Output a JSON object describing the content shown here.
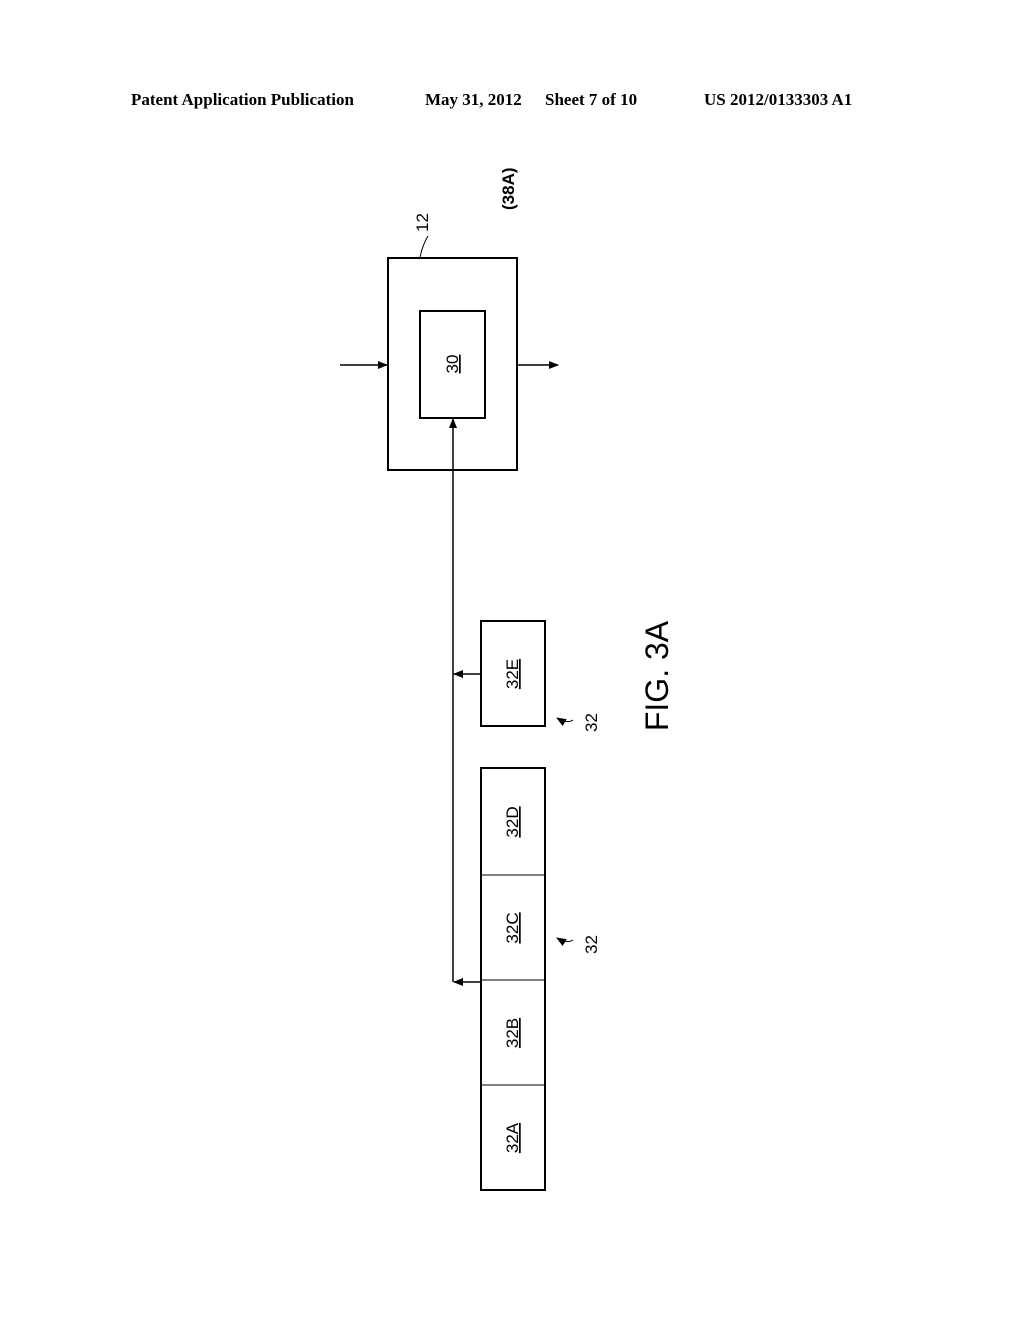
{
  "header": {
    "publication": "Patent Application Publication",
    "date": "May 31, 2012",
    "sheet": "Sheet 7 of 10",
    "number": "US 2012/0133303 A1"
  },
  "figure": {
    "caption": "FIG. 3A",
    "state_label": "(38A)",
    "device_ref": "12",
    "inner_block": "30",
    "group_ref_1": "32",
    "group_ref_2": "32",
    "blocks": [
      "32A",
      "32B",
      "32C",
      "32D"
    ],
    "single_block": "32E"
  }
}
